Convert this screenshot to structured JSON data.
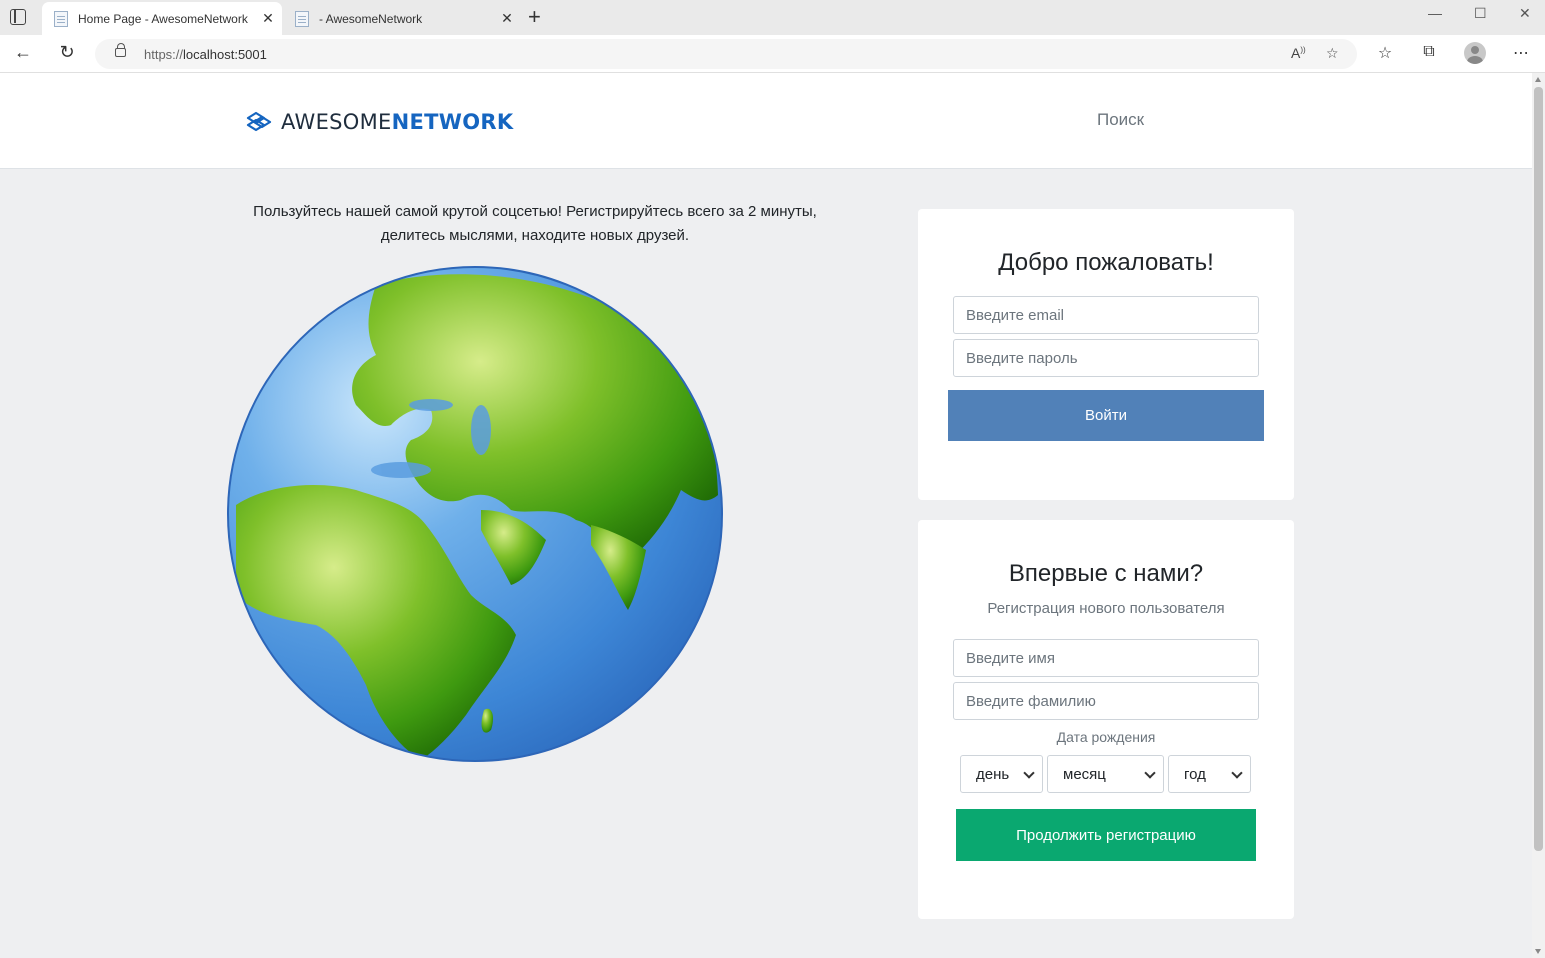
{
  "browser": {
    "tabs": [
      {
        "title": "Home Page - AwesomeNetwork",
        "active": true
      },
      {
        "title": "- AwesomeNetwork",
        "active": false
      }
    ],
    "new_tab": "+",
    "url_prefix": "https://",
    "url_host": "localhost:5001",
    "window_controls": {
      "minimize": "—",
      "maximize": "☐",
      "close": "✕"
    }
  },
  "header": {
    "logo_light": "AWESOME",
    "logo_bold": "NETWORK",
    "nav_search": "Поиск"
  },
  "intro": {
    "text": "Пользуйтесь нашей самой крутой соцсетью! Регистрируйтесь всего за 2 минуты, делитесь мыслями, находите новых друзей."
  },
  "login": {
    "title": "Добро пожаловать!",
    "email_placeholder": "Введите email",
    "password_placeholder": "Введите пароль",
    "submit": "Войти"
  },
  "register": {
    "title": "Впервые с нами?",
    "subtitle": "Регистрация нового пользователя",
    "first_name_placeholder": "Введите имя",
    "last_name_placeholder": "Введите фамилию",
    "dob_label": "Дата рождения",
    "day": "день",
    "month": "месяц",
    "year": "год",
    "submit": "Продолжить регистрацию"
  },
  "colors": {
    "login_button": "#5181b8",
    "register_button": "#0aa870",
    "brand": "#1565c0"
  }
}
